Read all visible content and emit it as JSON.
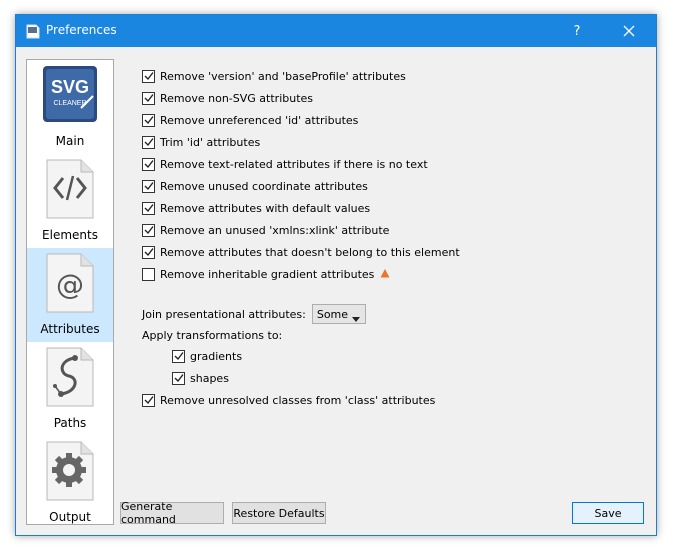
{
  "window": {
    "title": "Preferences",
    "help_label": "?",
    "accent_color": "#1a86e0"
  },
  "sidebar": {
    "items": [
      {
        "label": "Main",
        "icon": "svg-cleaner-logo-icon",
        "logo_lines": [
          "SVG",
          "CLEANER"
        ],
        "selected": false
      },
      {
        "label": "Elements",
        "icon": "code-brackets-icon",
        "selected": false
      },
      {
        "label": "Attributes",
        "icon": "at-sign-icon",
        "selected": true
      },
      {
        "label": "Paths",
        "icon": "bezier-path-icon",
        "selected": false
      },
      {
        "label": "Output",
        "icon": "gear-icon",
        "selected": false
      }
    ]
  },
  "options": [
    {
      "label": "Remove 'version' and 'baseProfile' attributes",
      "checked": true
    },
    {
      "label": "Remove non-SVG attributes",
      "checked": true
    },
    {
      "label": "Remove unreferenced 'id' attributes",
      "checked": true
    },
    {
      "label": "Trim 'id' attributes",
      "checked": true
    },
    {
      "label": "Remove text-related attributes if there is no text",
      "checked": true
    },
    {
      "label": "Remove unused coordinate attributes",
      "checked": true
    },
    {
      "label": "Remove attributes with default values",
      "checked": true
    },
    {
      "label": "Remove an unused 'xmlns:xlink' attribute",
      "checked": true
    },
    {
      "label": "Remove attributes that doesn't belong to this element",
      "checked": true
    },
    {
      "label": "Remove inheritable gradient attributes",
      "checked": false,
      "warning": true
    }
  ],
  "join": {
    "label": "Join presentational attributes:",
    "value": "Some"
  },
  "transform": {
    "label": "Apply transformations to:",
    "items": [
      {
        "label": "gradients",
        "checked": true
      },
      {
        "label": "shapes",
        "checked": true
      }
    ]
  },
  "last_option": {
    "label": "Remove unresolved classes from 'class' attributes",
    "checked": true
  },
  "buttons": {
    "generate": "Generate command",
    "restore": "Restore Defaults",
    "save": "Save"
  },
  "colors": {
    "selected_bg": "#cce8ff",
    "warning": "#e8762c"
  }
}
